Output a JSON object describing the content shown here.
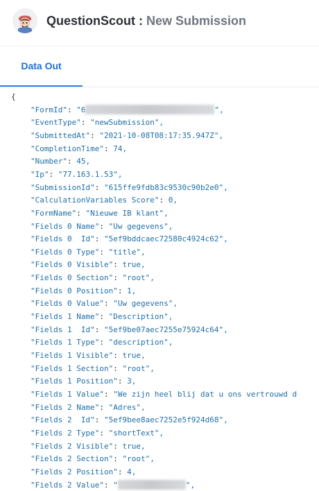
{
  "header": {
    "app_name": "QuestionScout",
    "separator": " : ",
    "event_name": "New Submission"
  },
  "tabs": [
    {
      "label": "Data Out",
      "active": true
    }
  ],
  "code": {
    "open_brace": "{",
    "lines": [
      {
        "key": "\"FormId\"",
        "sep": ": ",
        "value": "\"6",
        "suffix": "\",",
        "redacted": true
      },
      {
        "key": "\"EventType\"",
        "sep": ": ",
        "value": "\"newSubmission\"",
        "suffix": ","
      },
      {
        "key": "\"SubmittedAt\"",
        "sep": ": ",
        "value": "\"2021-10-08T08:17:35.947Z\"",
        "suffix": ","
      },
      {
        "key": "\"CompletionTime\"",
        "sep": ": ",
        "value": "74",
        "suffix": ","
      },
      {
        "key": "\"Number\"",
        "sep": ": ",
        "value": "45",
        "suffix": ","
      },
      {
        "key": "\"Ip\"",
        "sep": ": ",
        "value": "\"77.163.1.53\"",
        "suffix": ","
      },
      {
        "key": "\"SubmissionId\"",
        "sep": ": ",
        "value": "\"615ffe9fdb83c9530c90b2e0\"",
        "suffix": ","
      },
      {
        "key": "\"CalculationVariables Score\"",
        "sep": ": ",
        "value": "0",
        "suffix": ","
      },
      {
        "key": "\"FormName\"",
        "sep": ": ",
        "value": "\"Nieuwe IB klant\"",
        "suffix": ","
      },
      {
        "key": "\"Fields 0 Name\"",
        "sep": ": ",
        "value": "\"Uw gegevens\"",
        "suffix": ","
      },
      {
        "key": "\"Fields 0  Id\"",
        "sep": ": ",
        "value": "\"5ef9bddcaec72580c4924c62\"",
        "suffix": ","
      },
      {
        "key": "\"Fields 0 Type\"",
        "sep": ": ",
        "value": "\"title\"",
        "suffix": ","
      },
      {
        "key": "\"Fields 0 Visible\"",
        "sep": ": ",
        "value": "true",
        "suffix": ","
      },
      {
        "key": "\"Fields 0 Section\"",
        "sep": ": ",
        "value": "\"root\"",
        "suffix": ","
      },
      {
        "key": "\"Fields 0 Position\"",
        "sep": ": ",
        "value": "1",
        "suffix": ","
      },
      {
        "key": "\"Fields 0 Value\"",
        "sep": ": ",
        "value": "\"Uw gegevens\"",
        "suffix": ","
      },
      {
        "key": "\"Fields 1 Name\"",
        "sep": ": ",
        "value": "\"Description\"",
        "suffix": ","
      },
      {
        "key": "\"Fields 1  Id\"",
        "sep": ": ",
        "value": "\"5ef9be07aec7255e75924c64\"",
        "suffix": ","
      },
      {
        "key": "\"Fields 1 Type\"",
        "sep": ": ",
        "value": "\"description\"",
        "suffix": ","
      },
      {
        "key": "\"Fields 1 Visible\"",
        "sep": ": ",
        "value": "true",
        "suffix": ","
      },
      {
        "key": "\"Fields 1 Section\"",
        "sep": ": ",
        "value": "\"root\"",
        "suffix": ","
      },
      {
        "key": "\"Fields 1 Position\"",
        "sep": ": ",
        "value": "3",
        "suffix": ","
      },
      {
        "key": "\"Fields 1 Value\"",
        "sep": ": ",
        "value": "\"We zijn heel blij dat u ons vertrouwd d",
        "suffix": ""
      },
      {
        "key": "\"Fields 2 Name\"",
        "sep": ": ",
        "value": "\"Adres\"",
        "suffix": ","
      },
      {
        "key": "\"Fields 2  Id\"",
        "sep": ": ",
        "value": "\"5ef9bee8aec7252e5f924d68\"",
        "suffix": ","
      },
      {
        "key": "\"Fields 2 Type\"",
        "sep": ": ",
        "value": "\"shortText\"",
        "suffix": ","
      },
      {
        "key": "\"Fields 2 Visible\"",
        "sep": ": ",
        "value": "true",
        "suffix": ","
      },
      {
        "key": "\"Fields 2 Section\"",
        "sep": ": ",
        "value": "\"root\"",
        "suffix": ","
      },
      {
        "key": "\"Fields 2 Position\"",
        "sep": ": ",
        "value": "4",
        "suffix": ","
      },
      {
        "key": "\"Fields 2 Value\"",
        "sep": ": ",
        "value": "\"",
        "suffix": "\",",
        "redacted": true,
        "redact_short": true
      }
    ]
  }
}
